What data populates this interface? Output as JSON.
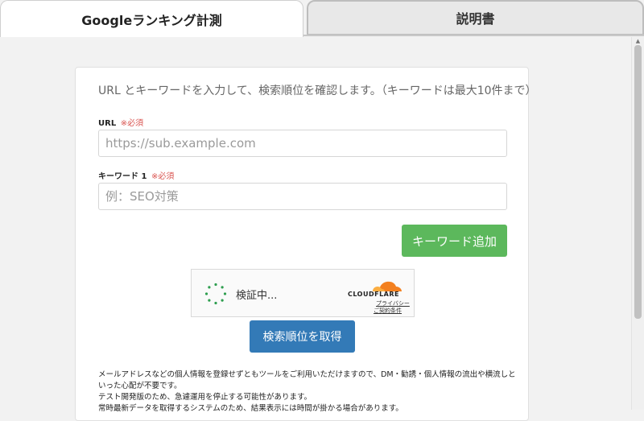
{
  "tabs": [
    {
      "label": "Googleランキング計測",
      "active": true
    },
    {
      "label": "説明書",
      "active": false
    }
  ],
  "form": {
    "intro": "URL とキーワードを入力して、検索順位を確認します。（キーワードは最大10件まで）",
    "url_label": "URL",
    "required_mark": "※必須",
    "url_placeholder": "https://sub.example.com",
    "keyword_label": "キーワード 1",
    "keyword_placeholder": "例：SEO対策",
    "add_keyword_button": "キーワード追加",
    "submit_button": "検索順位を取得"
  },
  "captcha": {
    "status": "検証中...",
    "brand": "CLOUDFLARE",
    "privacy_link": "プライバシー",
    "terms_link": "ご契約条件"
  },
  "notes": [
    "メールアドレスなどの個人情報を登録せずともツールをご利用いただけますので、DM・勧誘・個人情報の流出や横流しといった心配が不要です。",
    "テスト開発版のため、急遽運用を停止する可能性があります。",
    "常時最新データを取得するシステムのため、結果表示には時間が掛かる場合があります。"
  ],
  "colors": {
    "add_button": "#5cb85c",
    "submit_button": "#337ab7",
    "required": "#d9534f",
    "cloudflare_orange": "#f38020"
  }
}
